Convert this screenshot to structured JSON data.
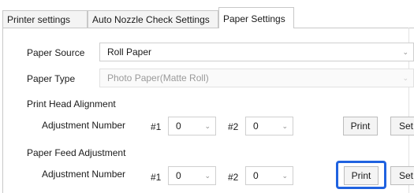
{
  "tabs": [
    {
      "label": "Printer settings"
    },
    {
      "label": "Auto Nozzle Check Settings"
    },
    {
      "label": "Paper Settings"
    }
  ],
  "paper_source": {
    "label": "Paper Source",
    "value": "Roll Paper"
  },
  "paper_type": {
    "label": "Paper Type",
    "value": "Photo Paper(Matte Roll)"
  },
  "print_head_alignment": {
    "heading": "Print Head Alignment",
    "adjustment_label": "Adjustment Number",
    "n1_label": "#1",
    "n1_value": "0",
    "n2_label": "#2",
    "n2_value": "0",
    "print_label": "Print",
    "set_label": "Set"
  },
  "paper_feed_adjustment": {
    "heading": "Paper Feed Adjustment",
    "adjustment_label": "Adjustment Number",
    "n1_label": "#1",
    "n1_value": "0",
    "n2_label": "#2",
    "n2_value": "0",
    "print_label": "Print",
    "set_label": "Set"
  },
  "icons": {
    "dropdown": "chevron-down-icon"
  },
  "colors": {
    "focus_ring": "#1f62e0",
    "border": "#c8c8c8"
  }
}
